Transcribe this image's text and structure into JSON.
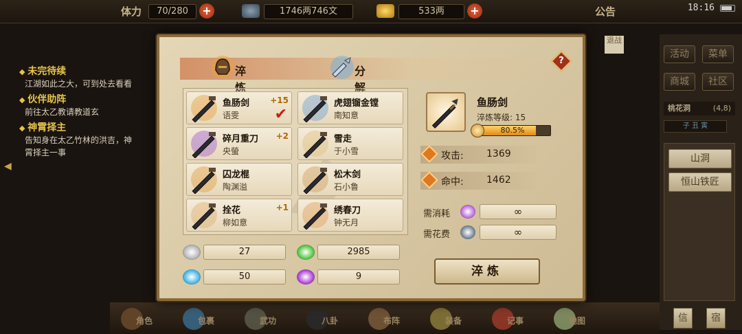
{
  "topbar": {
    "stamina_label": "体力",
    "stamina_value": "70/280",
    "money_value": "1746两746文",
    "gold_value": "533两",
    "notice_label": "公告",
    "clock": "18:16"
  },
  "quests": [
    {
      "title": "未完待续",
      "desc": "江湖如此之大，可到处去看看"
    },
    {
      "title": "伙伴助阵",
      "desc": "前往太乙教请教道玄"
    },
    {
      "title": "神霄择主",
      "desc": "告知身在太乙竹林的洪吉，神霄择主一事"
    }
  ],
  "right_menu": {
    "buttons": [
      "活动",
      "菜单",
      "商城",
      "社区"
    ],
    "location": "桃花洞",
    "coords": "(4,8)",
    "time_strip": "子 丑 寅",
    "places": [
      "山洞",
      "恒山铁匠"
    ]
  },
  "bottom_nav": [
    "角色",
    "包裹",
    "武功",
    "八卦",
    "布阵",
    "装备",
    "记事",
    "地图"
  ],
  "bottom_right": [
    "信",
    "宿"
  ],
  "side_tab": "退战",
  "dialog": {
    "tabs": [
      "淬炼",
      "分解"
    ],
    "help": "?",
    "items": [
      {
        "name": "鱼肠剑",
        "owner": "语雯",
        "plus": "+15",
        "selected": true
      },
      {
        "name": "虎翅镏金镗",
        "owner": "南知意",
        "plus": "",
        "selected": false
      },
      {
        "name": "碎月重刀",
        "owner": "央螢",
        "plus": "+2",
        "selected": false
      },
      {
        "name": "雪走",
        "owner": "于小雪",
        "plus": "",
        "selected": false
      },
      {
        "name": "囚龙棍",
        "owner": "陶渊溢",
        "plus": "",
        "selected": false
      },
      {
        "name": "松木剑",
        "owner": "石小鲁",
        "plus": "",
        "selected": false
      },
      {
        "name": "拴花",
        "owner": "柳如意",
        "plus": "+1",
        "selected": false
      },
      {
        "name": "绣春刀",
        "owner": "钟无月",
        "plus": "",
        "selected": false
      }
    ],
    "resources": [
      {
        "value": "27",
        "color": "#b8b8b8"
      },
      {
        "value": "2985",
        "color": "#5ac84a"
      },
      {
        "value": "50",
        "color": "#4ab8e8"
      },
      {
        "value": "9",
        "color": "#b048d8"
      }
    ],
    "detail": {
      "name": "鱼肠剑",
      "level_text": "淬炼等级: 15",
      "progress_text": "80.5%",
      "progress": 0.805,
      "stats": [
        {
          "label": "攻击:",
          "value": "1369"
        },
        {
          "label": "命中:",
          "value": "1462"
        }
      ],
      "needs": [
        {
          "label": "需消耗",
          "value": "∞",
          "color": "#c070e0"
        },
        {
          "label": "需花费",
          "value": "∞",
          "color": "#7a8a9a"
        }
      ],
      "button": "淬炼"
    }
  }
}
